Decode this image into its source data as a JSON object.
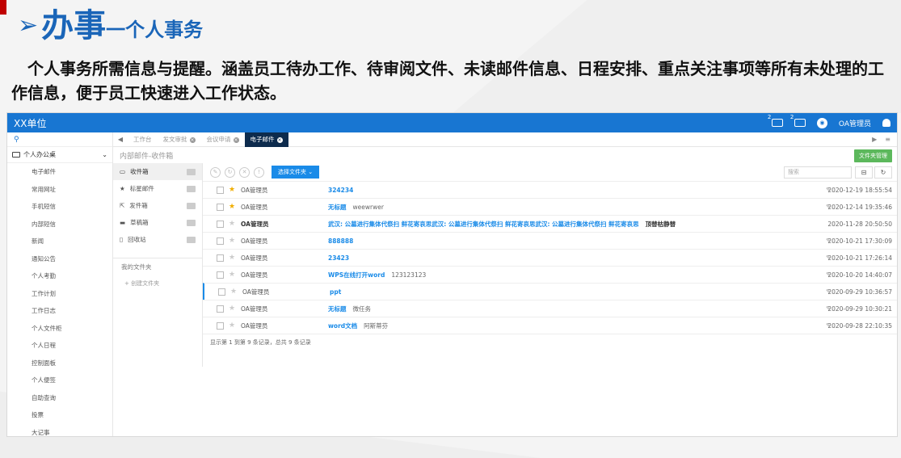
{
  "slide": {
    "title_main": "办事",
    "title_sub": "一个人事务",
    "description": "个人事务所需信息与提醒。涵盖员工待办工作、待审阅文件、未读邮件信息、日程安排、重点关注事项等所有未处理的工作信息，便于员工快速进入工作状态。"
  },
  "app": {
    "brand": "XX单位",
    "user": "OA管理员",
    "badges": [
      "2",
      "2"
    ],
    "sidebar": {
      "group": "个人办公桌",
      "items": [
        "电子邮件",
        "常用网址",
        "手机短信",
        "内部短信",
        "新闻",
        "通知公告",
        "个人考勤",
        "工作计划",
        "工作日志",
        "个人文件柜",
        "个人日程",
        "控制面板",
        "个人便签",
        "自助查询",
        "投票",
        "大记事"
      ]
    },
    "tabs": [
      {
        "label": "工作台",
        "active": false,
        "closable": false
      },
      {
        "label": "发文审批",
        "active": false,
        "closable": true
      },
      {
        "label": "会议申请",
        "active": false,
        "closable": true
      },
      {
        "label": "电子邮件",
        "active": true,
        "closable": true
      }
    ],
    "breadcrumb": "内部邮件-收件箱",
    "folder_manage_label": "文件夹管理",
    "folders": [
      {
        "label": "收件箱",
        "icon": "inbox-icon"
      },
      {
        "label": "标星邮件",
        "icon": "star-icon"
      },
      {
        "label": "发件箱",
        "icon": "outbox-icon"
      },
      {
        "label": "草稿箱",
        "icon": "draft-icon"
      },
      {
        "label": "回收站",
        "icon": "trash-icon"
      }
    ],
    "my_folders_label": "我的文件夹",
    "new_folder_label": "+ 创建文件夹",
    "select_folder_label": "选择文件夹",
    "search_placeholder": "搜索",
    "emails": [
      {
        "sender": "OA管理员",
        "subject": "324234",
        "preview": "",
        "date": "2020-12-19 18:55:54",
        "starred": true,
        "attachment": true,
        "bold": false
      },
      {
        "sender": "OA管理员",
        "subject": "无标题",
        "preview": "weewrwer",
        "date": "2020-12-14 19:35:46",
        "starred": true,
        "attachment": true,
        "bold": false
      },
      {
        "sender": "OA管理员",
        "subject": "武汉: 公墓进行集体代祭扫 鲜花寄哀思武汉: 公墓进行集体代祭扫 鲜花寄哀思武汉: 公墓进行集体代祭扫 鲜花寄哀思",
        "preview": "顶替枯静替",
        "date": "2020-11-28 20:50:50",
        "starred": false,
        "attachment": false,
        "bold": true
      },
      {
        "sender": "OA管理员",
        "subject": "888888",
        "preview": "",
        "date": "2020-10-21 17:30:09",
        "starred": false,
        "attachment": true,
        "bold": false
      },
      {
        "sender": "OA管理员",
        "subject": "23423",
        "preview": "",
        "date": "2020-10-21 17:26:14",
        "starred": false,
        "attachment": true,
        "bold": false
      },
      {
        "sender": "OA管理员",
        "subject": "WPS在线打开word",
        "preview": "123123123",
        "date": "2020-10-20 14:40:07",
        "starred": false,
        "attachment": true,
        "bold": false
      },
      {
        "sender": "OA管理员",
        "subject": "ppt",
        "preview": "",
        "date": "2020-09-29 10:36:57",
        "starred": false,
        "attachment": true,
        "bold": false
      },
      {
        "sender": "OA管理员",
        "subject": "无标题",
        "preview": "微任务",
        "date": "2020-09-29 10:30:21",
        "starred": false,
        "attachment": true,
        "bold": false
      },
      {
        "sender": "OA管理员",
        "subject": "word文档",
        "preview": "阿斯蒂芬",
        "date": "2020-09-28 22:10:35",
        "starred": false,
        "attachment": true,
        "bold": false
      }
    ],
    "footer": "显示第 1 到第 9 条记录，总共 9 条记录"
  }
}
